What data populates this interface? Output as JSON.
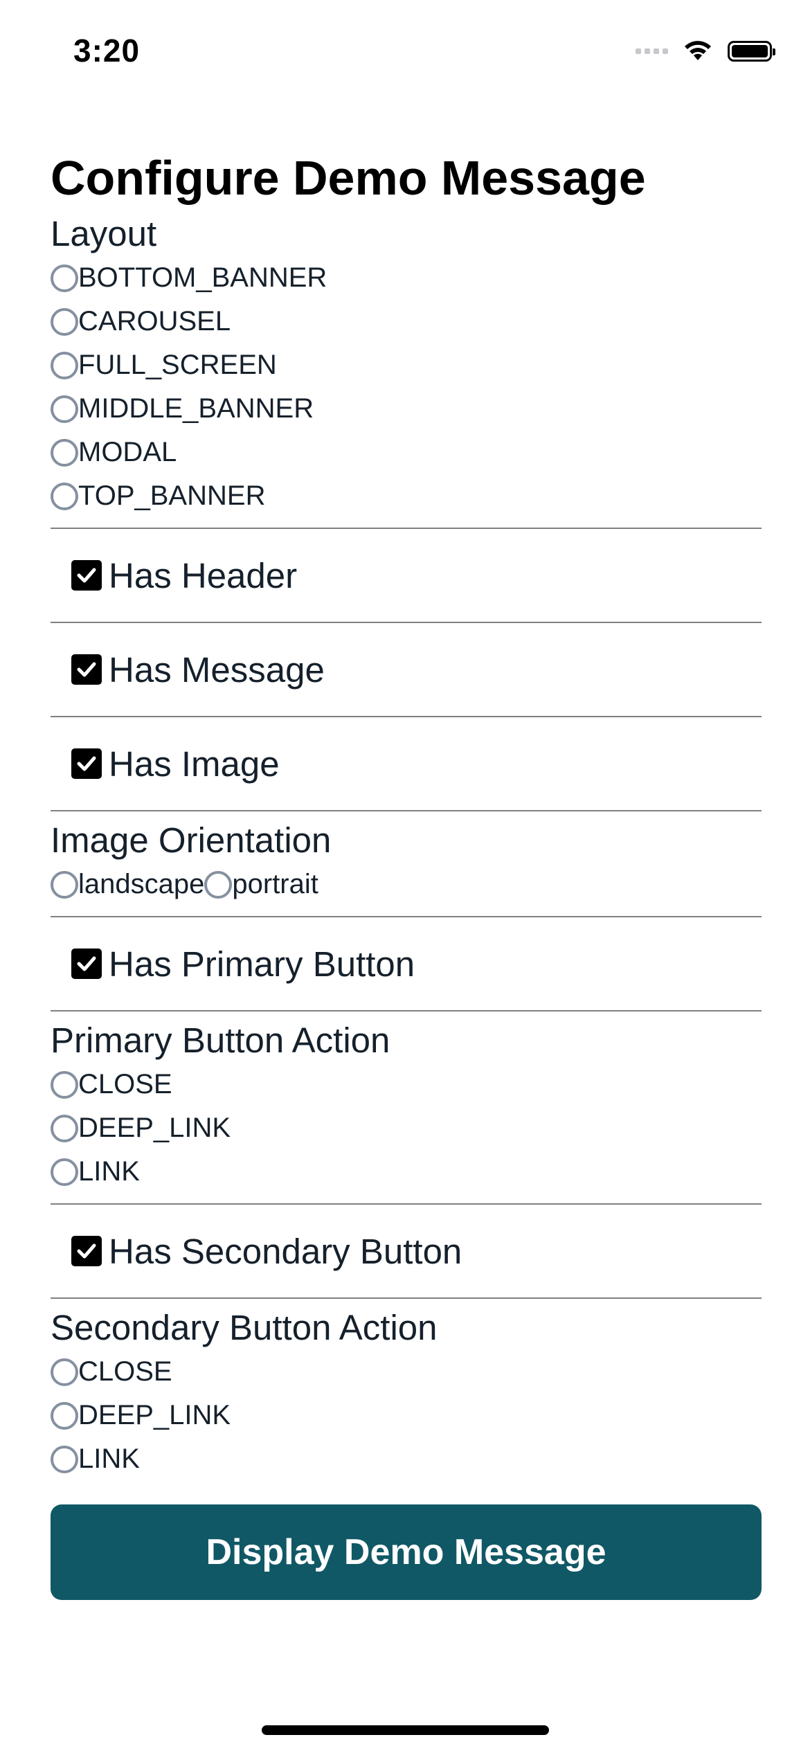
{
  "status_bar": {
    "time": "3:20"
  },
  "title": "Configure Demo Message",
  "layout": {
    "label": "Layout",
    "options": [
      "BOTTOM_BANNER",
      "CAROUSEL",
      "FULL_SCREEN",
      "MIDDLE_BANNER",
      "MODAL",
      "TOP_BANNER"
    ],
    "selected": null
  },
  "has_header": {
    "label": "Has Header",
    "checked": true
  },
  "has_message": {
    "label": "Has Message",
    "checked": true
  },
  "has_image": {
    "label": "Has Image",
    "checked": true
  },
  "image_orientation": {
    "label": "Image Orientation",
    "options": [
      "landscape",
      "portrait"
    ],
    "selected": null
  },
  "has_primary_button": {
    "label": "Has Primary Button",
    "checked": true
  },
  "primary_button_action": {
    "label": "Primary Button Action",
    "options": [
      "CLOSE",
      "DEEP_LINK",
      "LINK"
    ],
    "selected": null
  },
  "has_secondary_button": {
    "label": "Has Secondary Button",
    "checked": true
  },
  "secondary_button_action": {
    "label": "Secondary Button Action",
    "options": [
      "CLOSE",
      "DEEP_LINK",
      "LINK"
    ],
    "selected": null
  },
  "display_button": {
    "label": "Display Demo Message"
  },
  "colors": {
    "button_background": "#115866",
    "checkbox": "#000000",
    "radio_border": "#8590a0",
    "divider": "#808080"
  }
}
